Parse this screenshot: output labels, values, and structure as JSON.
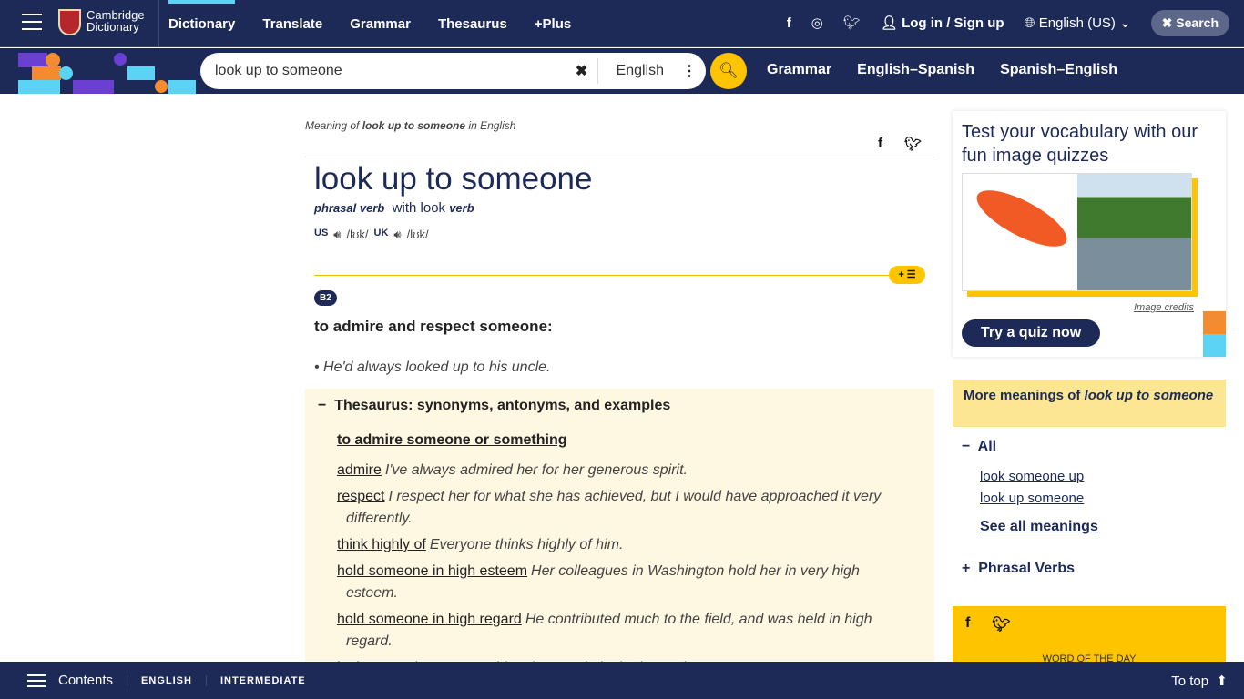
{
  "header": {
    "logo": [
      "Cambridge",
      "Dictionary"
    ],
    "nav": [
      "Dictionary",
      "Translate",
      "Grammar",
      "Thesaurus",
      "+Plus"
    ],
    "login": "Log in / Sign up",
    "language": "English (US)",
    "search": "Search"
  },
  "searchbar": {
    "value": "look up to someone",
    "dictionary": "English",
    "links": [
      "Grammar",
      "English–Spanish",
      "Spanish–English"
    ]
  },
  "entry": {
    "crumb_pre": "Meaning of ",
    "crumb_word": "look up to someone",
    "crumb_post": " in English",
    "headword": "look up to someone",
    "pos": "phrasal verb",
    "with": "with look",
    "with_pos": "verb",
    "us": "US",
    "uk": "UK",
    "ipa_us": "/lʊk/",
    "ipa_uk": "/lʊk/",
    "level": "B2",
    "definition": "to admire and respect someone:",
    "example": "He'd always looked up to his uncle."
  },
  "thesaurus": {
    "title": "Thesaurus: synonyms, antonyms, and examples",
    "sense": "to admire someone or something",
    "items": [
      {
        "word": "admire",
        "ex": "I've always admired her for her generous spirit."
      },
      {
        "word": "respect",
        "ex": "I respect her for what she has achieved, but I would have approached it very differently."
      },
      {
        "word": "think highly of",
        "ex": "Everyone thinks highly of him."
      },
      {
        "word": "hold someone in high esteem",
        "ex": "Her colleagues in Washington hold her in very high esteem."
      },
      {
        "word": "hold someone in high regard",
        "ex": "He contributed much to the field, and was held in high regard."
      },
      {
        "word": "look up to",
        "ex": "She was my older sister and I looked up to her."
      }
    ]
  },
  "sidebar": {
    "quiz_title": "Test your vocabulary with our fun image quizzes",
    "credits": "Image credits",
    "try": "Try a quiz now",
    "more_pre": "More meanings of ",
    "more_word": "look up to someone",
    "all": "All",
    "meanings": [
      "look someone up",
      "look up someone"
    ],
    "see_all": "See all meanings",
    "phrasal": "Phrasal Verbs",
    "wotd": "WORD OF THE DAY"
  },
  "footer": {
    "contents": "Contents",
    "tags": [
      "ENGLISH",
      "INTERMEDIATE"
    ],
    "to_top": "To top"
  },
  "colors": {
    "navy": "#1d2a57",
    "yellow": "#fec400",
    "cream": "#fef7e1"
  }
}
